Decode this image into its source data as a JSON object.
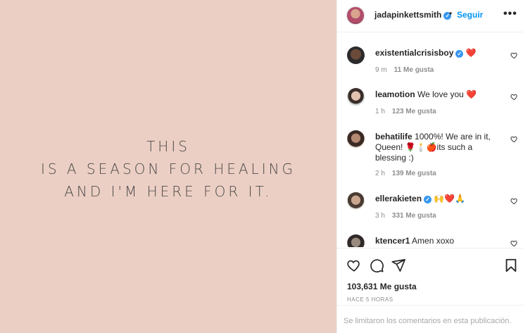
{
  "post": {
    "quote_lines": [
      "THIS",
      "IS A SEASON FOR HEALING",
      "AND I'M HERE FOR IT."
    ]
  },
  "header": {
    "username": "jadapinkettsmith",
    "separator": "•",
    "follow_label": "Seguir",
    "more_label": "•••"
  },
  "comments": [
    {
      "user": "existentialcrisisboy",
      "verified": true,
      "text": "❤️",
      "time": "9 m",
      "likes": "11 Me gusta"
    },
    {
      "user": "leamotion",
      "verified": false,
      "text": "We love you ❤️",
      "time": "1 h",
      "likes": "123 Me gusta"
    },
    {
      "user": "behatilife",
      "verified": false,
      "text": "1000%! We are in it, Queen! 🌹🕯️🍎its such a blessing :)",
      "time": "2 h",
      "likes": "139 Me gusta"
    },
    {
      "user": "ellerakieten",
      "verified": true,
      "text": "🙌❤️🙏",
      "time": "3 h",
      "likes": "331 Me gusta"
    },
    {
      "user": "ktencer1",
      "verified": false,
      "text": "Amen xoxo",
      "time": "",
      "likes": ""
    }
  ],
  "actions": {
    "likes_total": "103,631 Me gusta",
    "time_ago": "HACE 5 HORAS"
  },
  "footer": {
    "limited_notice": "Se limitaron los comentarios en esta publicación."
  },
  "icons": [
    "heart-icon",
    "comment-icon",
    "share-icon",
    "bookmark-icon",
    "more-options-icon",
    "verified-badge-icon"
  ],
  "colors": {
    "background_image": "#eccfc4",
    "link_blue": "#0095f6",
    "verified_blue": "#3897f0",
    "muted": "#8e8e8e"
  }
}
